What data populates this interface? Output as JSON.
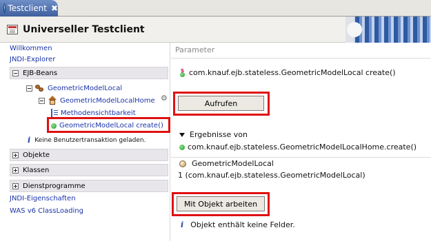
{
  "tab": {
    "title": "Testclient",
    "close_glyph": "✖",
    "icon": "globe-icon"
  },
  "header": {
    "title": "Universeller Testclient"
  },
  "left": {
    "links_top": [
      "Willkommen",
      "JNDI-Explorer"
    ],
    "ejb_group": "EJB-Beans",
    "tree": {
      "bean": "GeometricModelLocal",
      "home": "GeometricModelLocalHome",
      "methods": "Methodensichtbarkeit",
      "create": "GeometricModelLocal create()"
    },
    "note": "Keine Benutzertransaktion geladen.",
    "groups": [
      "Objekte",
      "Klassen",
      "Dienstprogramme"
    ],
    "links_bottom": [
      "JNDI-Eigenschaften",
      "WAS v6 ClassLoading"
    ]
  },
  "right": {
    "section_title": "Parameter",
    "method_signature": "com.knauf.ejb.stateless.GeometricModelLocal create()",
    "invoke_button": "Aufrufen",
    "results_label": "Ergebnisse von",
    "results_call": "com.knauf.ejb.stateless.GeometricModelLocalHome.create()",
    "object_name": "GeometricModelLocal",
    "object_value": "1 (com.knauf.ejb.stateless.GeometricModelLocal)",
    "work_button": "Mit Objekt arbeiten",
    "info_text": "Objekt enthält keine Felder."
  },
  "colors": {
    "highlight": "#e01010",
    "link": "#1a33a8",
    "tab": "#4f6fae"
  }
}
